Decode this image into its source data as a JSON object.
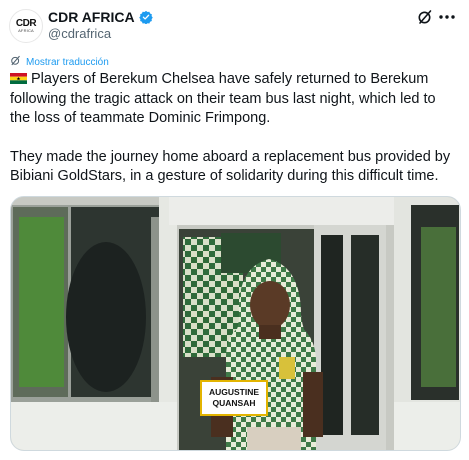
{
  "account": {
    "logo_text": "CDR",
    "logo_subtext": "AFRICA",
    "name": "CDR AFRICA",
    "handle": "@cdrafrica",
    "verified_color": "#1d9bf0"
  },
  "actions": {
    "grok_icon": "grok-slash-icon",
    "more_icon": "more-horizontal-icon"
  },
  "translate": {
    "label": "Mostrar traducción",
    "color": "#1d9bf0"
  },
  "tweet": {
    "paragraph_1": "Players of Berekum Chelsea have safely returned to Berekum following the tragic attack on their team bus last night, which led to the loss of teammate Dominic Frimpong.",
    "paragraph_2": "They made the journey home aboard a replacement bus provided by Bibiani GoldStars, in a gesture of solidarity during this difficult time.",
    "flag": "ghana-flag-emoji"
  },
  "media": {
    "caption_line_1": "AUGUSTINE",
    "caption_line_2": "QUANSAH"
  }
}
